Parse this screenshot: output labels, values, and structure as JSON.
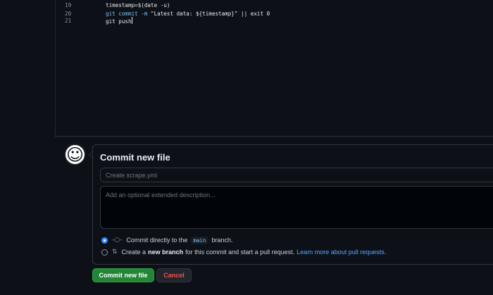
{
  "editor": {
    "lines": [
      {
        "number": "19",
        "segments": [
          {
            "text": "timestamp=$(date -u)",
            "kind": "plain"
          }
        ]
      },
      {
        "number": "20",
        "segments": [
          {
            "text": "git commit -m ",
            "kind": "kw"
          },
          {
            "text": "\"Latest data: ${timestamp}\" || exit 0",
            "kind": "plain"
          }
        ]
      },
      {
        "number": "21",
        "segments": [
          {
            "text": "git push",
            "kind": "plain"
          }
        ]
      }
    ]
  },
  "commit": {
    "avatar_icon": "smiley-icon",
    "title": "Commit new file",
    "summary_placeholder": "Create scrape.yml",
    "description_placeholder": "Add an optional extended description...",
    "option_direct": {
      "icon": "commit-icon",
      "prefix": "Commit directly to the",
      "branch": "main",
      "suffix": "branch.",
      "checked": true
    },
    "option_new_branch": {
      "icon": "pull-request-icon",
      "prefix": "Create a",
      "bold": "new branch",
      "suffix": "for this commit and start a pull request.",
      "link": "Learn more about pull requests.",
      "checked": false
    },
    "submit_label": "Commit new file",
    "cancel_label": "Cancel"
  },
  "colors": {
    "background": "#0d1117",
    "primary_button": "#238636",
    "danger_text": "#f85149",
    "link": "#58a6ff",
    "accent_radio": "#388bfd"
  }
}
